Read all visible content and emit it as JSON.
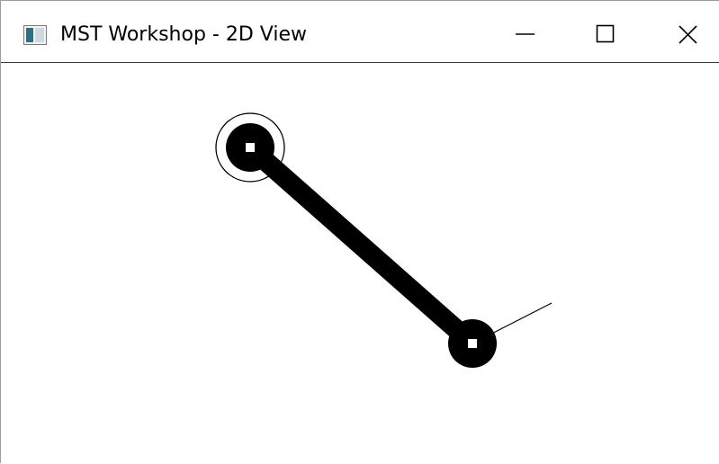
{
  "window": {
    "title": "MST Workshop - 2D View",
    "app_icon": "window-app-icon",
    "controls": {
      "minimize": "minimize-icon",
      "maximize": "maximize-icon",
      "close": "close-icon"
    }
  },
  "view": {
    "background": "#ffffff",
    "edge_color": "#000000",
    "node_fill": "#000000",
    "node_center": "#ffffff",
    "selection_ring_color": "#000000"
  }
}
